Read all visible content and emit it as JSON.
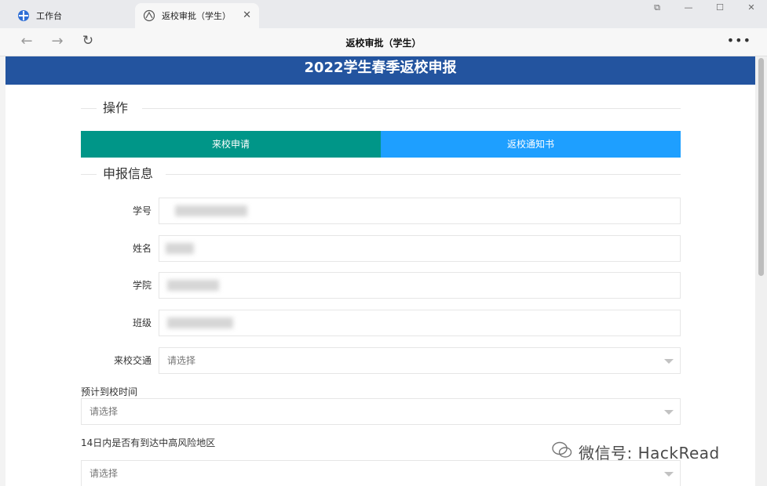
{
  "tabs": [
    {
      "label": "工作台",
      "icon": "workbench-icon"
    },
    {
      "label": "返校审批（学生）",
      "icon": "app-logo-icon"
    }
  ],
  "toolbar": {
    "page_title": "返校审批（学生）"
  },
  "banner": {
    "title": "2022学生春季返校申报"
  },
  "sections": {
    "operations": "操作",
    "info": "申报信息"
  },
  "actions": {
    "apply_label": "来校申请",
    "notice_label": "返校通知书"
  },
  "fields": {
    "student_id": "学号",
    "name": "姓名",
    "college": "学院",
    "class": "班级",
    "transport": "来校交通"
  },
  "selects": {
    "transport_value": "请选择",
    "arrival_label": "预计到校时间",
    "arrival_value": "请选择",
    "risk_label": "14日内是否有到达中高风险地区",
    "risk_value": "请选择"
  },
  "watermark": {
    "text": "微信号: HackRead"
  },
  "colors": {
    "banner": "#23549f",
    "green": "#009688",
    "blue": "#1e9fff"
  }
}
